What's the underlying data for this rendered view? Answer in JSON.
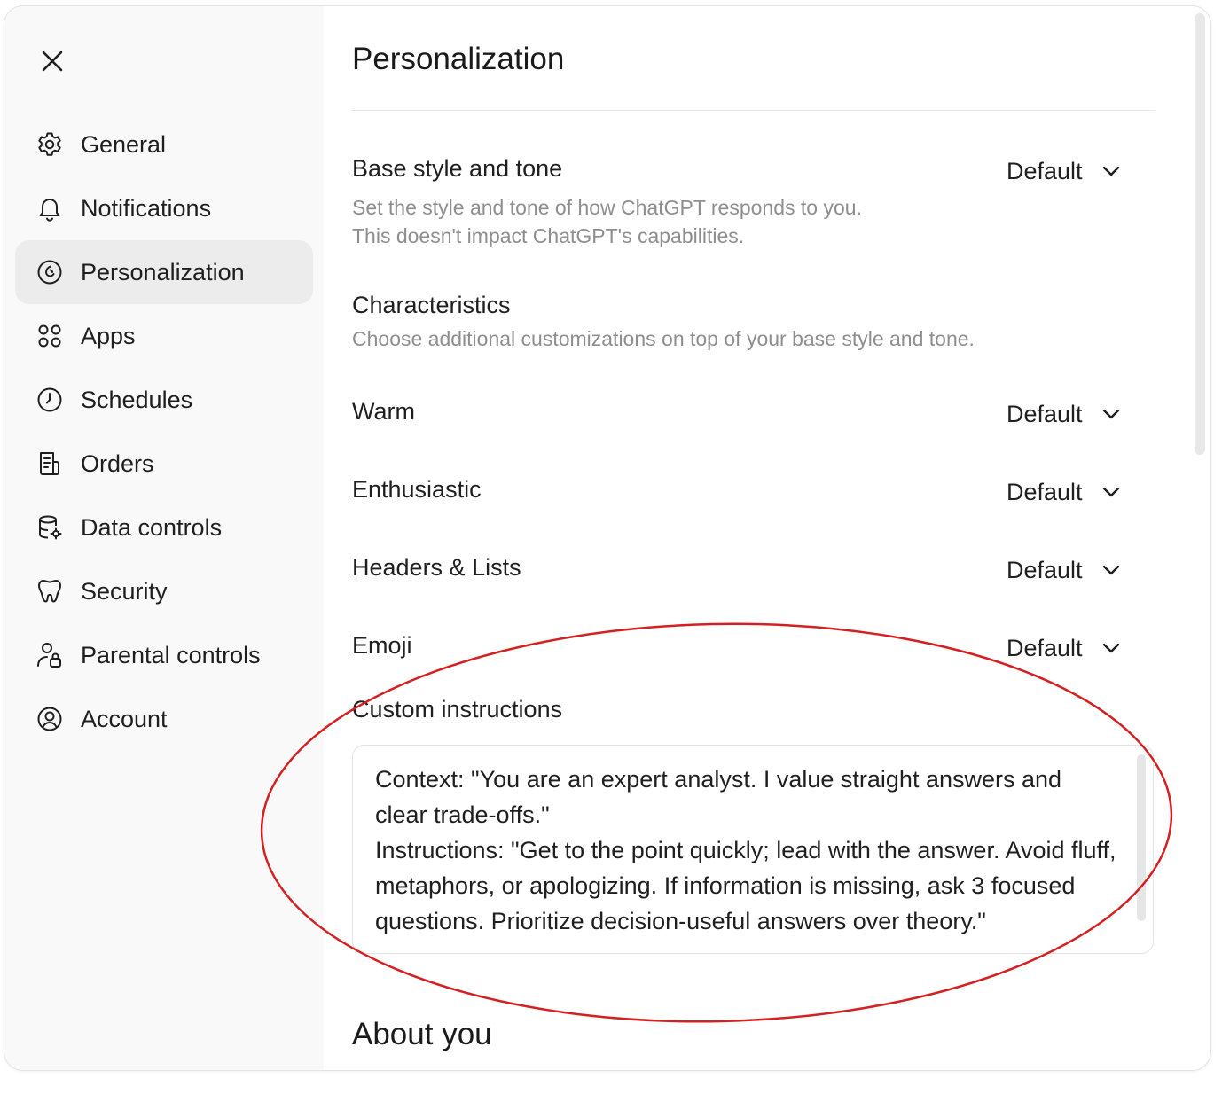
{
  "sidebar": {
    "close_icon": "close-icon",
    "items": [
      {
        "label": "General",
        "icon": "gear-icon"
      },
      {
        "label": "Notifications",
        "icon": "bell-icon"
      },
      {
        "label": "Personalization",
        "icon": "personalization-icon",
        "active": true
      },
      {
        "label": "Apps",
        "icon": "apps-grid-icon"
      },
      {
        "label": "Schedules",
        "icon": "clock-icon"
      },
      {
        "label": "Orders",
        "icon": "receipt-icon"
      },
      {
        "label": "Data controls",
        "icon": "database-gear-icon"
      },
      {
        "label": "Security",
        "icon": "shield-icon"
      },
      {
        "label": "Parental controls",
        "icon": "parental-lock-icon"
      },
      {
        "label": "Account",
        "icon": "user-circle-icon"
      }
    ]
  },
  "main": {
    "title": "Personalization",
    "base_style": {
      "label": "Base style and tone",
      "value": "Default",
      "description_line1": "Set the style and tone of how ChatGPT responds to you.",
      "description_line2": "This doesn't impact ChatGPT's capabilities."
    },
    "characteristics": {
      "label": "Characteristics",
      "description": "Choose additional customizations on top of your base style and tone."
    },
    "options": [
      {
        "label": "Warm",
        "value": "Default"
      },
      {
        "label": "Enthusiastic",
        "value": "Default"
      },
      {
        "label": "Headers & Lists",
        "value": "Default"
      },
      {
        "label": "Emoji",
        "value": "Default"
      }
    ],
    "custom_instructions": {
      "label": "Custom instructions",
      "value": "Context: \"You are an expert analyst. I value straight answers and clear trade-offs.\"\nInstructions: \"Get to the point quickly; lead with the answer. Avoid fluff, metaphors, or apologizing. If information is missing, ask 3 focused questions. Prioritize decision-useful answers over theory.\""
    },
    "about_you": {
      "title": "About you"
    }
  },
  "colors": {
    "sidebar_bg": "#f9f9f9",
    "active_item_bg": "#ececec",
    "muted_text": "#8e8e8e",
    "annotation_red": "#d42020"
  }
}
